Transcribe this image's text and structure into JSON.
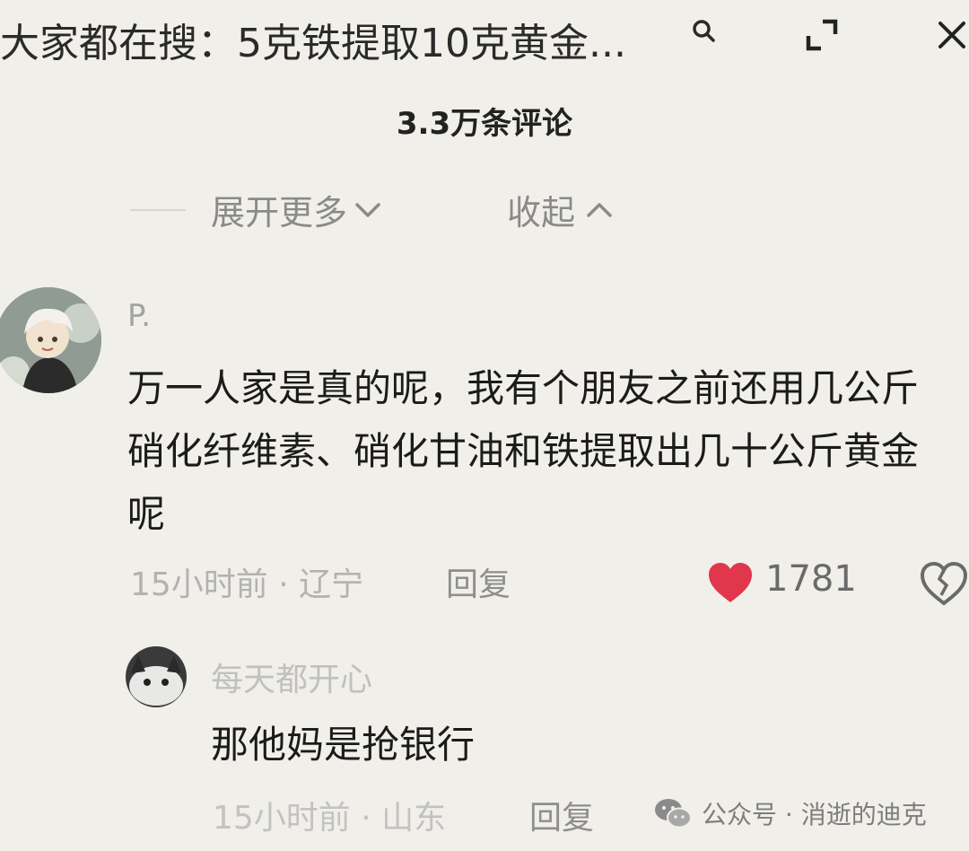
{
  "header": {
    "search_text": "大家都在搜：5克铁提取10克黄金...",
    "icons": [
      "search-icon",
      "expand-icon",
      "close-icon"
    ]
  },
  "comments_header": {
    "count_label": "3.3万条评论",
    "expand_more_label": "展开更多",
    "collapse_label": "收起"
  },
  "comment": {
    "username": "P.",
    "text": "万一人家是真的呢，我有个朋友之前还用几公斤硝化纤维素、硝化甘油和铁提取出几十公斤黄金呢",
    "meta": "15小时前 · 辽宁",
    "reply_label": "回复",
    "likes": "1781",
    "heart_color": "#e0374c"
  },
  "reply": {
    "username": "每天都开心",
    "text": "那他妈是抢银行",
    "meta": "15小时前 · 山东",
    "reply_label": "回复"
  },
  "watermark": {
    "text": "公众号 · 消逝的迪克"
  }
}
